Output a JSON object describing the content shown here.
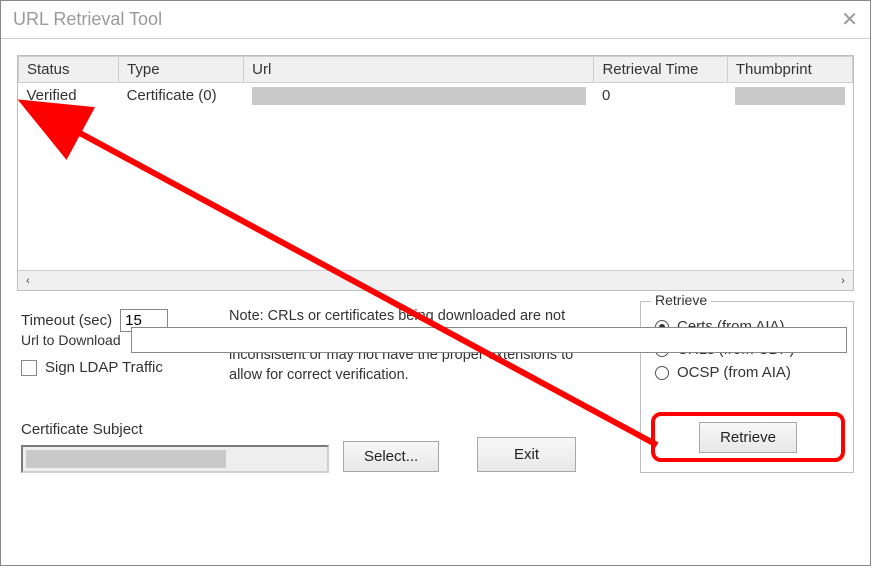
{
  "window": {
    "title": "URL Retrieval Tool"
  },
  "table": {
    "headers": {
      "status": "Status",
      "type": "Type",
      "url": "Url",
      "retrieval_time": "Retrieval Time",
      "thumbprint": "Thumbprint"
    },
    "rows": [
      {
        "status": "Verified",
        "type": "Certificate (0)",
        "url": "",
        "retrieval_time": "0",
        "thumbprint": ""
      }
    ]
  },
  "timeout": {
    "label": "Timeout (sec)",
    "value": "15"
  },
  "sign_ldap": {
    "label": "Sign LDAP Traffic",
    "checked": false
  },
  "note": "Note: CRLs or certificates being downloaded are not exhaustively verified.  A CRL or cert may still be inconsistent or may not have the proper extensions to allow for correct verification.",
  "retrieve": {
    "legend": "Retrieve",
    "options": [
      {
        "label": "Certs (from AIA)",
        "checked": true
      },
      {
        "label": "CRLs (from CDP)",
        "checked": false
      },
      {
        "label": "OCSP (from AIA)",
        "checked": false
      }
    ],
    "button": "Retrieve"
  },
  "cert_subject": {
    "label": "Certificate Subject",
    "value": ""
  },
  "buttons": {
    "select": "Select...",
    "exit": "Exit"
  },
  "url_download": {
    "label": "Url to Download",
    "value": ""
  },
  "annotation_arrow": {
    "from": "retrieve-button",
    "to": "status-verified-cell",
    "color": "#f00"
  }
}
